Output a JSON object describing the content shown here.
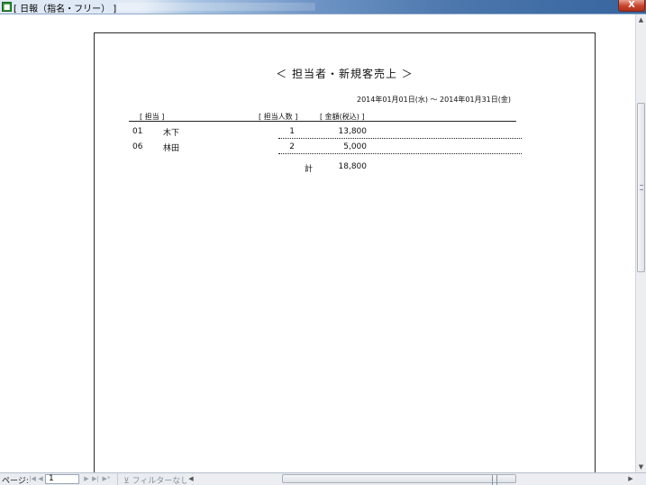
{
  "window": {
    "title": "[ 日報（指名・フリー） ]",
    "close_glyph": "X"
  },
  "report": {
    "title": "＜ 担当者・新規客売上 ＞",
    "date_range": "2014年01月01日(水) 〜 2014年01月31日(金)",
    "columns": {
      "staff": "[ 担当 ]",
      "count": "[ 担当人数 ]",
      "amount": "[ 金額(税込) ]"
    },
    "rows": [
      {
        "code": "01",
        "name": "木下",
        "count": "1",
        "amount": "13,800"
      },
      {
        "code": "06",
        "name": "林田",
        "count": "2",
        "amount": "5,000"
      }
    ],
    "total_label": "計",
    "total_amount": "18,800"
  },
  "navigation": {
    "page_label": "ページ:",
    "current_page": "1",
    "filter_status": "フィルターなし"
  },
  "icons": {
    "app": "access-report-icon",
    "filter": "filter-off-icon"
  }
}
